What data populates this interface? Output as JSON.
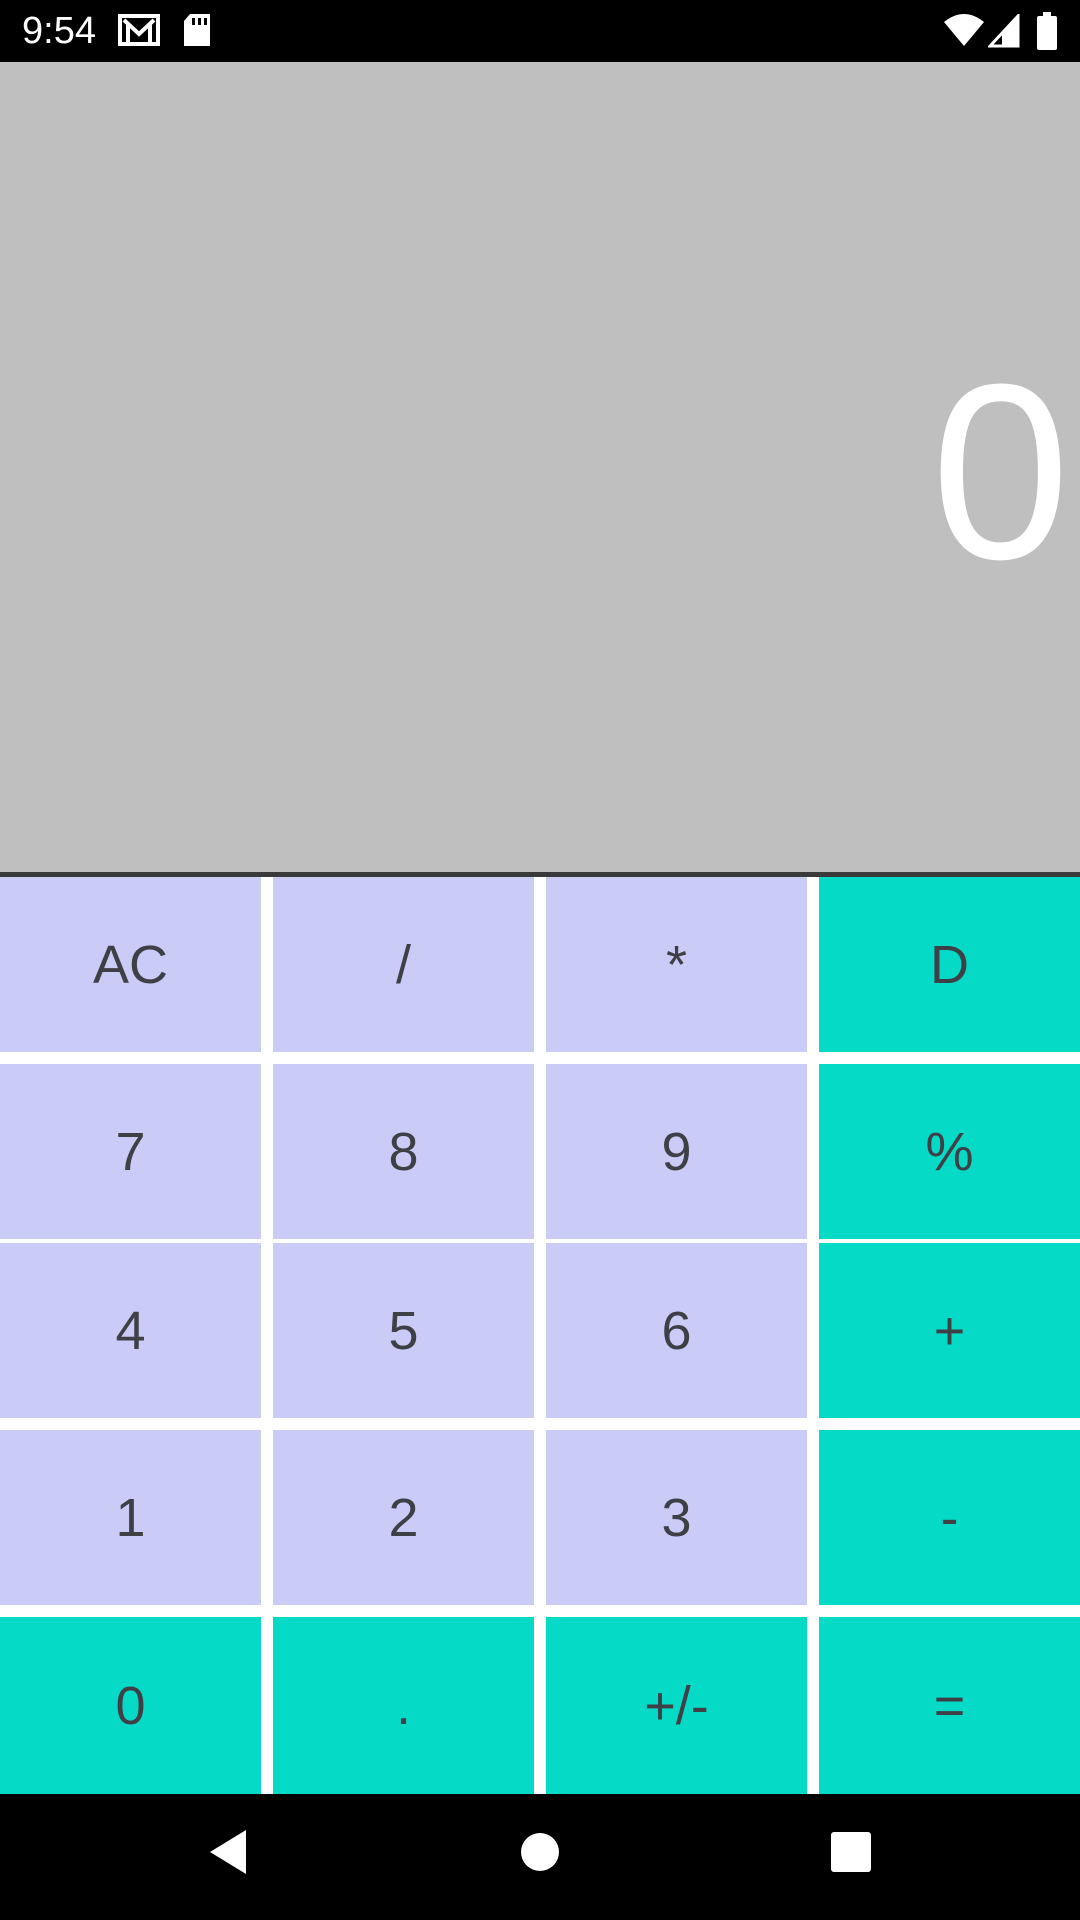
{
  "status_bar": {
    "time": "9:54",
    "icons": [
      "gmail-icon",
      "sd-card-icon",
      "wifi-icon",
      "cellular-signal-icon",
      "battery-icon"
    ]
  },
  "display": {
    "value": "0"
  },
  "keypad": {
    "rows": [
      [
        {
          "label": "AC",
          "style": "light"
        },
        {
          "label": "/",
          "style": "light"
        },
        {
          "label": "*",
          "style": "light"
        },
        {
          "label": "D",
          "style": "teal"
        }
      ],
      [
        {
          "label": "7",
          "style": "light"
        },
        {
          "label": "8",
          "style": "light"
        },
        {
          "label": "9",
          "style": "light"
        },
        {
          "label": "%",
          "style": "teal"
        }
      ],
      [
        {
          "label": "4",
          "style": "light"
        },
        {
          "label": "5",
          "style": "light"
        },
        {
          "label": "6",
          "style": "light"
        },
        {
          "label": "+",
          "style": "teal"
        }
      ],
      [
        {
          "label": "1",
          "style": "light"
        },
        {
          "label": "2",
          "style": "light"
        },
        {
          "label": "3",
          "style": "light"
        },
        {
          "label": "-",
          "style": "teal"
        }
      ],
      [
        {
          "label": "0",
          "style": "teal"
        },
        {
          "label": ".",
          "style": "teal"
        },
        {
          "label": "+/-",
          "style": "teal"
        },
        {
          "label": "=",
          "style": "teal"
        }
      ]
    ]
  },
  "colors": {
    "display_bg": "#c0bfc0",
    "key_light": "#cbcbf8",
    "key_accent": "#04dac6",
    "key_text": "#3f3f46"
  },
  "nav_bar": {
    "icons": [
      "back-icon",
      "home-icon",
      "recents-icon"
    ]
  }
}
